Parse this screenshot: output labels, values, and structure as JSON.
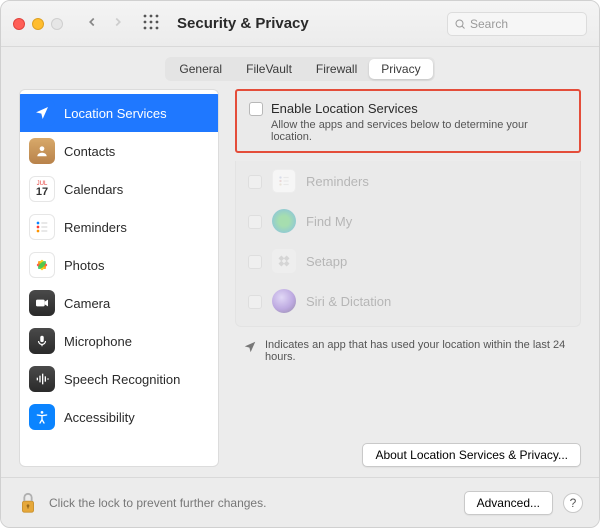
{
  "window": {
    "title": "Security & Privacy"
  },
  "search": {
    "placeholder": "Search"
  },
  "tabs": [
    {
      "label": "General",
      "selected": false
    },
    {
      "label": "FileVault",
      "selected": false
    },
    {
      "label": "Firewall",
      "selected": false
    },
    {
      "label": "Privacy",
      "selected": true
    }
  ],
  "sidebar": {
    "items": [
      {
        "label": "Location Services",
        "icon": "location",
        "selected": true
      },
      {
        "label": "Contacts",
        "icon": "contacts",
        "selected": false
      },
      {
        "label": "Calendars",
        "icon": "calendar",
        "selected": false
      },
      {
        "label": "Reminders",
        "icon": "reminders",
        "selected": false
      },
      {
        "label": "Photos",
        "icon": "photos",
        "selected": false
      },
      {
        "label": "Camera",
        "icon": "camera",
        "selected": false
      },
      {
        "label": "Microphone",
        "icon": "microphone",
        "selected": false
      },
      {
        "label": "Speech Recognition",
        "icon": "speech",
        "selected": false
      },
      {
        "label": "Accessibility",
        "icon": "accessibility",
        "selected": false
      }
    ]
  },
  "enable": {
    "label": "Enable Location Services",
    "sub": "Allow the apps and services below to determine your location."
  },
  "apps": [
    {
      "label": "Reminders",
      "icon": "reminders"
    },
    {
      "label": "Find My",
      "icon": "findmy"
    },
    {
      "label": "Setapp",
      "icon": "setapp"
    },
    {
      "label": "Siri & Dictation",
      "icon": "siri"
    }
  ],
  "legend": {
    "text": "Indicates an app that has used your location within the last 24 hours."
  },
  "about_btn": "About Location Services & Privacy...",
  "footer": {
    "lock_text": "Click the lock to prevent further changes.",
    "advanced": "Advanced...",
    "help": "?"
  }
}
